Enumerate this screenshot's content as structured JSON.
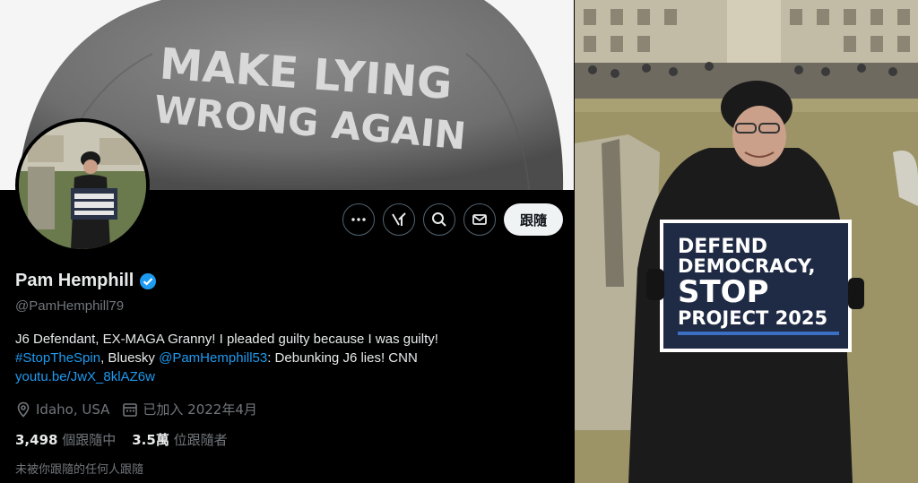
{
  "banner": {
    "line1": "MAKE LYING",
    "line2": "WRONG AGAIN"
  },
  "profile": {
    "name": "Pam Hemphill",
    "handle": "@PamHemphill79",
    "bio_line1": "J6 Defendant, EX-MAGA Granny! I pleaded guilty because I was guilty!",
    "bio_hashtag": "#StopTheSpin",
    "bio_mid": ", Bluesky ",
    "bio_mention": "@PamHemphill53",
    "bio_end": ": Debunking J6 lies! CNN",
    "bio_link": "youtu.be/JwX_8klAZ6w",
    "location": "Idaho, USA",
    "joined": "已加入 2022年4月",
    "following_count": "3,498",
    "following_label": "個跟隨中",
    "followers_count": "3.5萬",
    "followers_label": "位跟隨者",
    "not_followed_note": "未被你跟隨的任何人跟隨"
  },
  "actions": {
    "more_icon": "more-icon",
    "grok_icon": "grok-icon",
    "search_icon": "search-icon",
    "message_icon": "mail-icon",
    "follow_label": "跟隨"
  },
  "sign": {
    "line1": "DEFEND",
    "line2": "DEMOCRACY,",
    "line3": "STOP",
    "line4": "PROJECT 2025"
  },
  "colors": {
    "accent": "#1d9bf0",
    "verified": "#1d9bf0",
    "background": "#000000"
  }
}
